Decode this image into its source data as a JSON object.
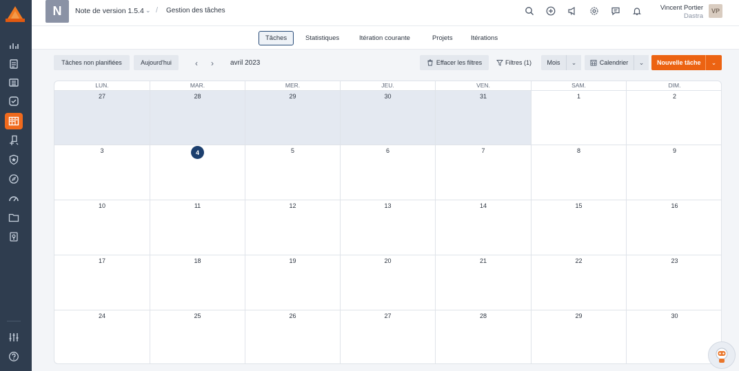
{
  "colors": {
    "accent": "#ec6312",
    "sidebar": "#2f3d4f",
    "today": "#1c3f6e",
    "outside_month": "#e4e9f1"
  },
  "sidebar": {
    "items": [
      {
        "icon": "chart-bars-icon"
      },
      {
        "icon": "document-icon"
      },
      {
        "icon": "list-icon"
      },
      {
        "icon": "check-shield-icon"
      },
      {
        "icon": "kanban-board-icon",
        "active": true
      },
      {
        "icon": "hierarchy-icon"
      },
      {
        "icon": "star-shield-icon"
      },
      {
        "icon": "compass-icon"
      },
      {
        "icon": "speedometer-icon"
      },
      {
        "icon": "folder-icon"
      },
      {
        "icon": "lightbulb-icon"
      },
      {
        "icon": "sliders-icon"
      },
      {
        "icon": "help-icon"
      }
    ]
  },
  "header": {
    "project_initial": "N",
    "project_name": "Note de version 1.5.4",
    "breadcrumb_current": "Gestion des tâches",
    "user_name": "Vincent Portier",
    "user_org": "Dastra",
    "user_initials": "VP",
    "icons": [
      "search-icon",
      "add-icon",
      "announce-icon",
      "settings-icon",
      "chat-icon",
      "bell-icon"
    ]
  },
  "tabs": [
    {
      "label": "Tâches",
      "active": true
    },
    {
      "label": "Statistiques"
    },
    {
      "label": "Itération courante"
    },
    {
      "label": "Projets"
    },
    {
      "label": "Itérations"
    }
  ],
  "toolbar": {
    "unplanned_label": "Tâches non planifiées",
    "today_label": "Aujourd'hui",
    "prev_symbol": "‹",
    "next_symbol": "›",
    "month_label": "avril 2023",
    "clear_filters_label": "Effacer les filtres",
    "filters_label": "Filtres (1)",
    "period_label": "Mois",
    "view_label": "Calendrier",
    "new_task_label": "Nouvelle tâche",
    "caret_symbol": "⌄"
  },
  "calendar": {
    "weekdays": [
      "LUN.",
      "MAR.",
      "MER.",
      "JEU.",
      "VEN.",
      "SAM.",
      "DIM."
    ],
    "today": 4,
    "weeks": [
      [
        {
          "d": "27",
          "o": true
        },
        {
          "d": "28",
          "o": true
        },
        {
          "d": "29",
          "o": true
        },
        {
          "d": "30",
          "o": true
        },
        {
          "d": "31",
          "o": true
        },
        {
          "d": "1"
        },
        {
          "d": "2"
        }
      ],
      [
        {
          "d": "3"
        },
        {
          "d": "4",
          "t": true
        },
        {
          "d": "5"
        },
        {
          "d": "6"
        },
        {
          "d": "7"
        },
        {
          "d": "8"
        },
        {
          "d": "9"
        }
      ],
      [
        {
          "d": "10"
        },
        {
          "d": "11"
        },
        {
          "d": "12"
        },
        {
          "d": "13"
        },
        {
          "d": "14"
        },
        {
          "d": "15"
        },
        {
          "d": "16"
        }
      ],
      [
        {
          "d": "17"
        },
        {
          "d": "18"
        },
        {
          "d": "19"
        },
        {
          "d": "20"
        },
        {
          "d": "21"
        },
        {
          "d": "22"
        },
        {
          "d": "23"
        }
      ],
      [
        {
          "d": "24"
        },
        {
          "d": "25"
        },
        {
          "d": "26"
        },
        {
          "d": "27"
        },
        {
          "d": "28"
        },
        {
          "d": "29"
        },
        {
          "d": "30"
        }
      ]
    ]
  }
}
